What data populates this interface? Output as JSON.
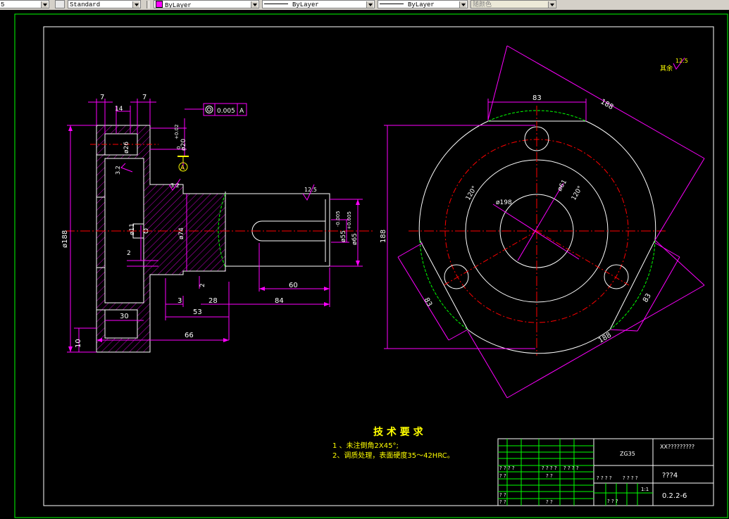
{
  "toolbar": {
    "style_value": "Standard",
    "layer_value": "ByLayer",
    "linetype_value": "ByLayer",
    "lineweight_value": "ByLayer",
    "plotstyle_value": "随颜色",
    "left_partial": "5"
  },
  "colors": {
    "background": "#000000",
    "white": "#ffffff",
    "magenta": "#ff00ff",
    "red": "#ff0000",
    "green": "#00ff00",
    "yellow": "#ffff00"
  },
  "drawing": {
    "side_view": {
      "dims": {
        "d7_left": "7",
        "d7_right": "7",
        "d14": "14",
        "d26": "ø26",
        "d20": "ø20",
        "tol_20": "+0.02",
        "tol_20b": "0",
        "d188": "ø188",
        "d30": "30",
        "d10": "10",
        "d66": "66",
        "d53": "53",
        "d3": "3",
        "d28": "28",
        "d84": "84",
        "d60": "60",
        "d2a": "2",
        "d2b": "2",
        "d11": "ø11",
        "d74": "ø74",
        "d55": "ø55",
        "tol_55": "-0.005",
        "d65": "ø65",
        "tol_65": "+0.005",
        "rough_32a": "3.2",
        "rough_32b": "3.2",
        "rough_125": "12.5",
        "datum_a": "A"
      },
      "gdt": {
        "symbol": "◎",
        "tolerance": "0.005",
        "datum": "A"
      }
    },
    "front_view": {
      "dims": {
        "d83_top": "83",
        "d188_top": "188",
        "d188_left": "188",
        "d188_bottom": "188",
        "d83_left": "83",
        "d83_right": "83",
        "d198": "ø198",
        "d61": "ø61",
        "a120a": "120°",
        "a120b": "120°"
      }
    },
    "remaining_roughness": {
      "label": "其余",
      "value": "12.5"
    },
    "tech_requirements": {
      "title": "技 术 要 求",
      "items": [
        "1 、未注倒角2X45°;",
        "2、调质处理，表面硬度35～42HRC。"
      ]
    },
    "title_block": {
      "material": "ZG35",
      "drawing_no": "XX?????????",
      "name": "???4",
      "code": "0.2.2-6",
      "scale": "1:1",
      "q1": "? ? ? ?",
      "q2": "? ? ? ?",
      "q3": "? ? ?",
      "row_labels": [
        "? ? ? ?",
        "? ? ? ?",
        "? ?",
        "? ?",
        "? ?"
      ],
      "col_labels": [
        "? ?",
        "? ? ? ?",
        "? ? ? ?",
        "? ?"
      ]
    }
  }
}
